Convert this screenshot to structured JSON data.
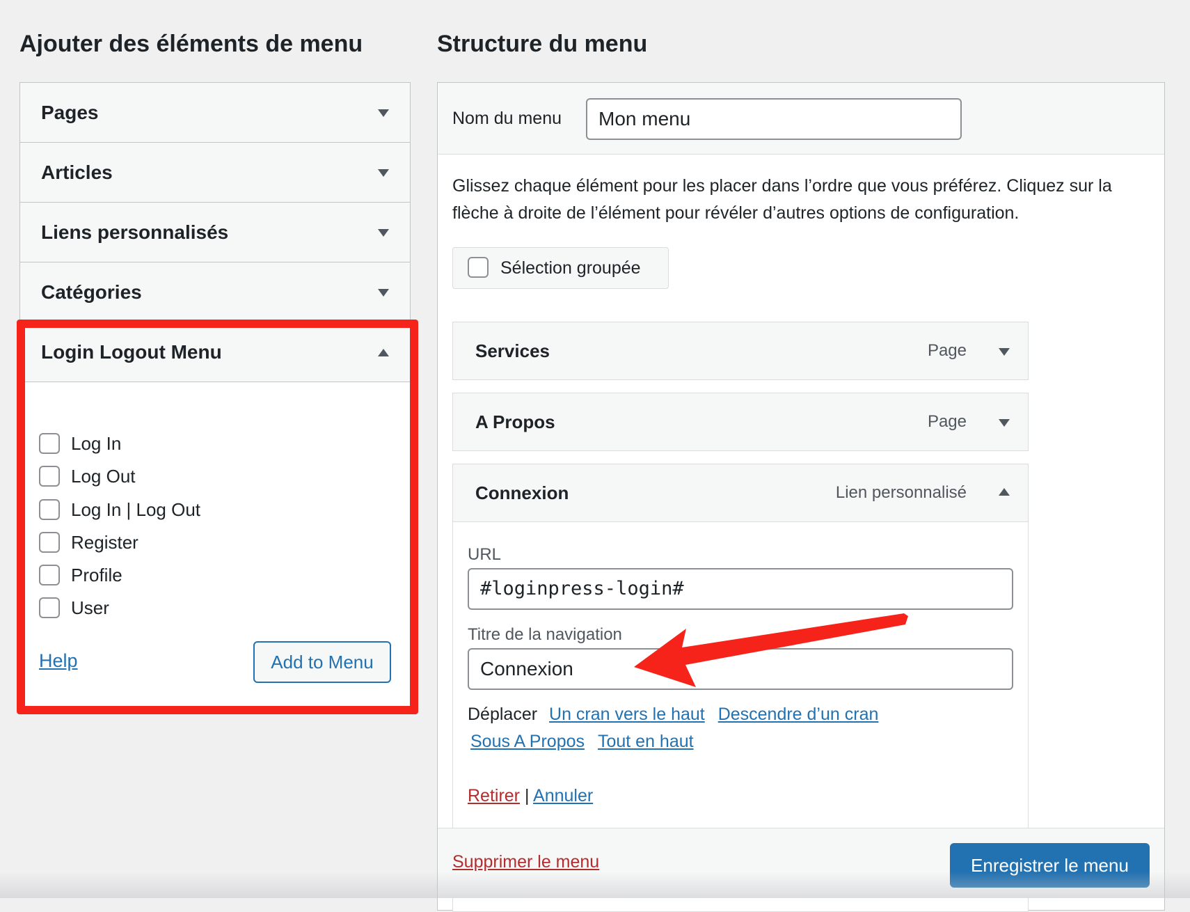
{
  "left": {
    "heading": "Ajouter des éléments de menu",
    "sections": [
      {
        "label": "Pages"
      },
      {
        "label": "Articles"
      },
      {
        "label": "Liens personnalisés"
      },
      {
        "label": "Catégories"
      }
    ],
    "login_logout": {
      "title": "Login Logout Menu",
      "options": [
        "Log In",
        "Log Out",
        "Log In | Log Out",
        "Register",
        "Profile",
        "User"
      ],
      "help_label": "Help",
      "add_button": "Add to Menu"
    }
  },
  "right": {
    "heading": "Structure du menu",
    "menu_name_label": "Nom du menu",
    "menu_name_value": "Mon menu",
    "instructions": "Glissez chaque élément pour les placer dans l’ordre que vous préférez. Cliquez sur la flèche à droite de l’élément pour révéler d’autres options de configuration.",
    "bulk_select_label": "Sélection groupée",
    "items": [
      {
        "title": "Services",
        "type": "Page"
      },
      {
        "title": "A Propos",
        "type": "Page"
      },
      {
        "title": "Connexion",
        "type": "Lien personnalisé"
      }
    ],
    "expanded": {
      "url_label": "URL",
      "url_value": "#loginpress-login#",
      "nav_label": "Titre de la navigation",
      "nav_value": "Connexion",
      "move_label": "Déplacer",
      "move_links": [
        "Un cran vers le haut",
        "Descendre d’un cran",
        "Sous A Propos",
        "Tout en haut"
      ],
      "remove_label": "Retirer",
      "separator": "|",
      "cancel_label": "Annuler"
    },
    "delete_menu_label": "Supprimer le menu",
    "save_button": "Enregistrer le menu"
  },
  "colors": {
    "accent": "#2271b1",
    "danger": "#b32d2e",
    "highlight": "#f6231a",
    "background": "#f0f0f1"
  }
}
